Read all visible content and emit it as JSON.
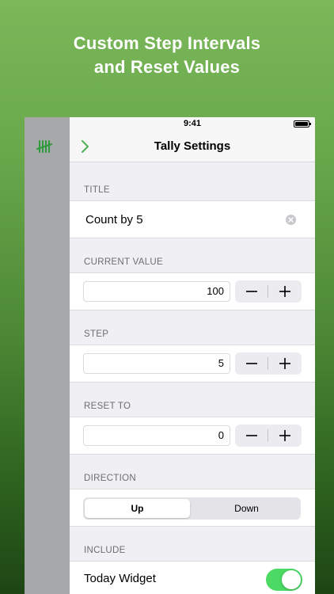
{
  "headline": {
    "line1": "Custom Step Intervals",
    "line2": "and Reset Values"
  },
  "status_bar": {
    "time": "9:41"
  },
  "nav": {
    "title": "Tally Settings",
    "back_icon": "chevron-right-icon",
    "accent_color": "#4caf50"
  },
  "sidebar": {
    "icon": "tally-marks-icon"
  },
  "sections": {
    "title": {
      "label": "TITLE",
      "value": "Count by 5"
    },
    "current_value": {
      "label": "CURRENT VALUE",
      "value": "100"
    },
    "step": {
      "label": "STEP",
      "value": "5"
    },
    "reset_to": {
      "label": "RESET TO",
      "value": "0"
    },
    "direction": {
      "label": "DIRECTION",
      "options": [
        "Up",
        "Down"
      ],
      "selected": "Up"
    },
    "include": {
      "label": "INCLUDE",
      "today_widget": {
        "label": "Today Widget",
        "enabled": true
      }
    }
  },
  "colors": {
    "toggle_on": "#4cd964",
    "background_top": "#7ab85a",
    "background_bottom": "#1d4514"
  }
}
